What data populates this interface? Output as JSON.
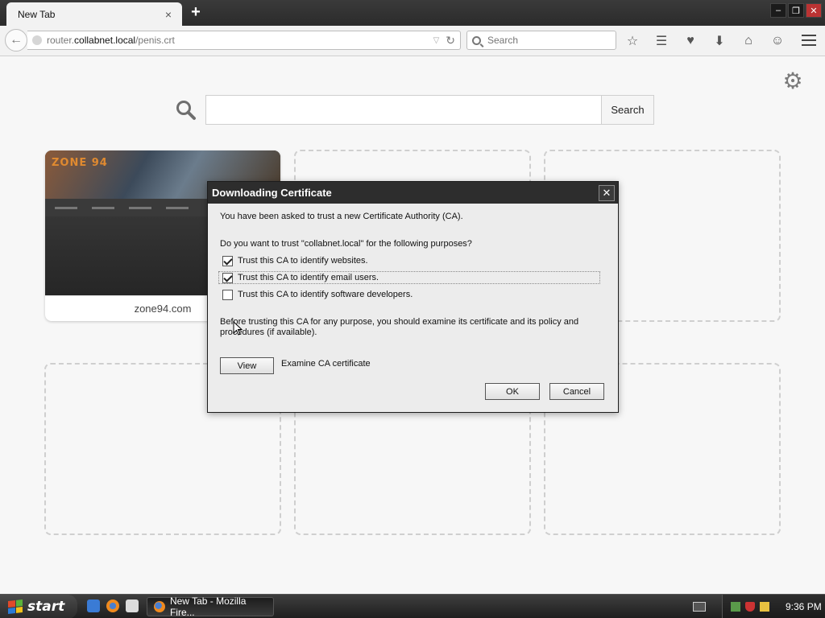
{
  "browser": {
    "tab_title": "New Tab",
    "tab_close": "×",
    "new_tab": "+",
    "url_prefix": "router.",
    "url_host": "collabnet.local",
    "url_path": "/penis.crt",
    "search_placeholder": "Search",
    "window_controls": [
      "minimize",
      "restore",
      "close"
    ]
  },
  "toolbar_icons": [
    "bookmark-star-icon",
    "reading-list-icon",
    "pocket-icon",
    "download-icon",
    "home-icon",
    "hello-icon",
    "menu-icon"
  ],
  "newtab": {
    "search_button": "Search",
    "tile_caption": "zone94.com",
    "thumb_logo": "ZONE 94"
  },
  "dialog": {
    "title": "Downloading Certificate",
    "close_glyph": "✕",
    "intro": "You have been asked to trust a new Certificate Authority (CA).",
    "question": "Do you want to trust \"collabnet.local\" for the following purposes?",
    "options": [
      {
        "label": "Trust this CA to identify websites.",
        "checked": true
      },
      {
        "label": "Trust this CA to identify email users.",
        "checked": true
      },
      {
        "label": "Trust this CA to identify software developers.",
        "checked": false
      }
    ],
    "warning_line1": "Before trusting this CA for any purpose, you should examine its certificate and its policy and",
    "warning_line2": "procedures (if available).",
    "view_button": "View",
    "examine_label": "Examine CA certificate",
    "ok_button": "OK",
    "cancel_button": "Cancel"
  },
  "taskbar": {
    "start_label": "start",
    "task_title": "New Tab - Mozilla Fire...",
    "clock": "9:36 PM"
  }
}
